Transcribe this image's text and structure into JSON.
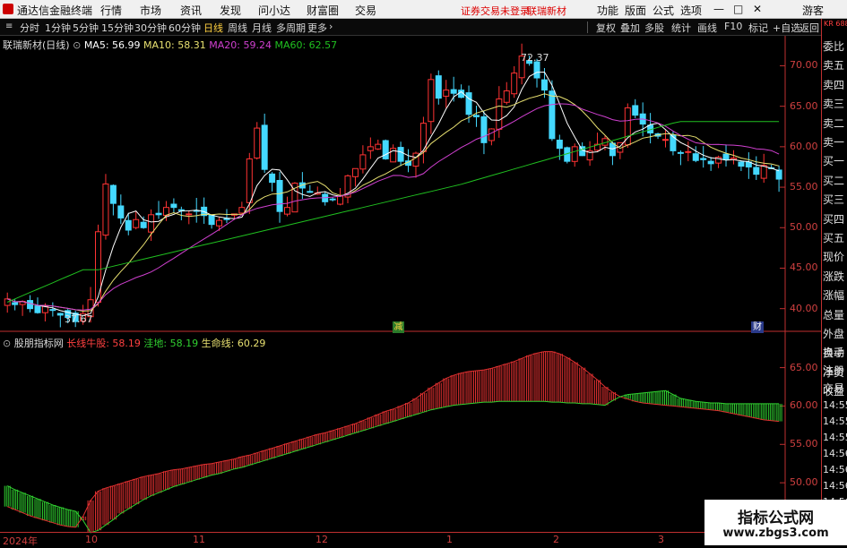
{
  "menubar": {
    "app_title": "通达信金融终端",
    "items": [
      "行情",
      "市场",
      "资讯",
      "发现",
      "问小达",
      "财富圈",
      "交易"
    ],
    "notice": "证券交易未登录",
    "stock": "联瑞新材",
    "right_items": [
      "功能",
      "版面",
      "公式",
      "选项"
    ],
    "guest": "游客"
  },
  "toolbar": {
    "periods": [
      "分时",
      "1分钟",
      "5分钟",
      "15分钟",
      "30分钟",
      "60分钟",
      "日线",
      "周线",
      "月线",
      "多周期",
      "更多"
    ],
    "active": "日线",
    "right_buttons": [
      "复权",
      "叠加",
      "多股",
      "统计",
      "画线",
      "F10",
      "标记",
      "+自选",
      "返回"
    ]
  },
  "main_chart_header": {
    "title": "联瑞新材(日线)",
    "ma5": "MA5: 56.99",
    "ma10": "MA10: 58.31",
    "ma20": "MA20: 59.24",
    "ma60": "MA60: 62.57"
  },
  "indicator_header": {
    "title": "股朋指标网",
    "long_line": "长线牛股: 58.19",
    "bottom": "洼地: 58.19",
    "lifeline": "生命线: 60.29"
  },
  "right_panel": {
    "code": "KR 688300",
    "labels": [
      "委比",
      "卖五",
      "卖四",
      "卖三",
      "卖二",
      "卖一",
      "买一",
      "买二",
      "买三",
      "买四",
      "买五",
      "现价",
      "涨跌",
      "涨幅",
      "总量",
      "外盘",
      "换手",
      "净资",
      "收益"
    ],
    "lower_labels": [
      "自动",
      "注册",
      "交易"
    ],
    "times": [
      "14:55",
      "14:55",
      "14:55",
      "14:56",
      "14:56",
      "14:56",
      "14:56",
      "14:56"
    ]
  },
  "badges": {
    "flag1": "减",
    "flag2": "财"
  },
  "date_axis": {
    "year": "2024年",
    "months": [
      "10",
      "11",
      "12",
      "1",
      "2",
      "3"
    ]
  },
  "watermark": {
    "title": "指标公式网",
    "url": "www.zbgs3.com"
  },
  "colors": {
    "up": "#ff3333",
    "down": "#44d8ff",
    "ma5": "#ffffff",
    "ma10": "#e8e070",
    "ma20": "#d040d0",
    "ma60": "#20c020",
    "axis": "#d04040",
    "green_hist": "#30d030"
  },
  "chart_data": [
    {
      "type": "candlestick",
      "title": "联瑞新材(日线)",
      "ylim": [
        38,
        74
      ],
      "yticks": [
        40,
        45,
        50,
        55,
        60,
        65,
        70
      ],
      "annotations": [
        {
          "label": "72.37",
          "value": 72.37
        },
        {
          "label": "37.67",
          "value": 37.67
        }
      ],
      "close": [
        41.2,
        40.5,
        40.9,
        40.0,
        39.5,
        40.3,
        39.8,
        39.2,
        38.9,
        38.4,
        39.4,
        41.1,
        49.5,
        55.4,
        53.0,
        51.2,
        49.7,
        51.0,
        50.0,
        51.6,
        51.6,
        52.5,
        52.5,
        52.1,
        51.7,
        52.1,
        51.5,
        50.4,
        50.9,
        51.0,
        51.7,
        52.5,
        58.5,
        62.3,
        57.2,
        55.6,
        52.0,
        52.5,
        55.5,
        54.9,
        54.4,
        54.3,
        53.2,
        53.5,
        53.9,
        56.4,
        57.3,
        59.0,
        60.0,
        60.3,
        58.5,
        59.8,
        58.2,
        57.7,
        59.2,
        62.9,
        68.3,
        66.0,
        67.0,
        66.6,
        66.1,
        64.0,
        63.7,
        60.5,
        62.2,
        65.9,
        66.9,
        69.1,
        71.2,
        70.3,
        68.5,
        67.0,
        61.0,
        59.8,
        58.2,
        60.0,
        58.9,
        59.5,
        60.3,
        61.0,
        58.9,
        60.5,
        64.8,
        63.9,
        62.8,
        61.7,
        61.3,
        60.9,
        59.5,
        59.2,
        59.4,
        58.3,
        58.4,
        57.9,
        58.7,
        58.4,
        58.6,
        57.6,
        57.5,
        56.6,
        57.7,
        57.3,
        56.0
      ],
      "series": [
        {
          "name": "MA5",
          "values": "computed"
        },
        {
          "name": "MA10",
          "values": "computed"
        },
        {
          "name": "MA20",
          "values": "computed"
        },
        {
          "name": "MA60",
          "values": "computed"
        }
      ]
    },
    {
      "type": "histogram",
      "title": "股朋指标网",
      "ylim": [
        44,
        69
      ],
      "yticks": [
        45,
        50,
        55,
        60,
        65
      ],
      "values": [
        46.9,
        46.5,
        46.1,
        45.7,
        45.4,
        45.1,
        44.8,
        44.5,
        44.3,
        44.2,
        45.6,
        47.7,
        48.9,
        49.3,
        49.6,
        49.9,
        50.2,
        50.5,
        50.8,
        51.0,
        51.2,
        51.5,
        51.7,
        51.8,
        52.0,
        52.2,
        52.4,
        52.5,
        52.7,
        52.9,
        53.1,
        53.4,
        53.6,
        53.9,
        54.2,
        54.5,
        54.8,
        55.1,
        55.4,
        55.7,
        56.0,
        56.3,
        56.5,
        56.8,
        57.1,
        57.4,
        57.7,
        58.1,
        58.5,
        58.9,
        59.3,
        59.6,
        60.0,
        60.4,
        61.0,
        61.7,
        62.4,
        63.0,
        63.6,
        64.0,
        64.3,
        64.5,
        64.6,
        64.7,
        64.9,
        65.2,
        65.5,
        65.8,
        66.2,
        66.6,
        66.9,
        67.1,
        67.1,
        66.8,
        66.3,
        65.7,
        65.0,
        64.2,
        63.4,
        62.5,
        61.8,
        61.2,
        60.9,
        60.6,
        60.4,
        60.3,
        60.2,
        60.1,
        60.0,
        59.9,
        59.8,
        59.7,
        59.6,
        59.5,
        59.4,
        59.2,
        59.0,
        58.8,
        58.6,
        58.4,
        58.2,
        58.1,
        58.0
      ],
      "baseline": "lifeline",
      "baseline_values": [
        49.6,
        49.1,
        48.7,
        48.3,
        47.9,
        47.5,
        47.1,
        46.8,
        46.5,
        46.3,
        45.1,
        43.5,
        43.8,
        44.5,
        45.2,
        46.0,
        46.6,
        47.2,
        47.8,
        48.3,
        48.7,
        49.1,
        49.5,
        49.8,
        50.1,
        50.4,
        50.7,
        51.0,
        51.2,
        51.5,
        51.8,
        52.0,
        52.3,
        52.6,
        52.9,
        53.2,
        53.5,
        53.8,
        54.1,
        54.4,
        54.7,
        55.0,
        55.3,
        55.6,
        55.9,
        56.2,
        56.5,
        56.8,
        57.1,
        57.4,
        57.7,
        58.0,
        58.3,
        58.6,
        58.9,
        59.2,
        59.5,
        59.7,
        59.9,
        60.1,
        60.2,
        60.3,
        60.4,
        60.5,
        60.5,
        60.6,
        60.6,
        60.6,
        60.6,
        60.6,
        60.6,
        60.6,
        60.5,
        60.5,
        60.4,
        60.4,
        60.3,
        60.3,
        60.2,
        60.1,
        60.7,
        61.2,
        61.5,
        61.6,
        61.7,
        61.8,
        61.9,
        62.0,
        61.5,
        61.0,
        60.8,
        60.6,
        60.5,
        60.4,
        60.4,
        60.3,
        60.3,
        60.3,
        60.3,
        60.3,
        60.3,
        60.3,
        60.29
      ]
    }
  ]
}
